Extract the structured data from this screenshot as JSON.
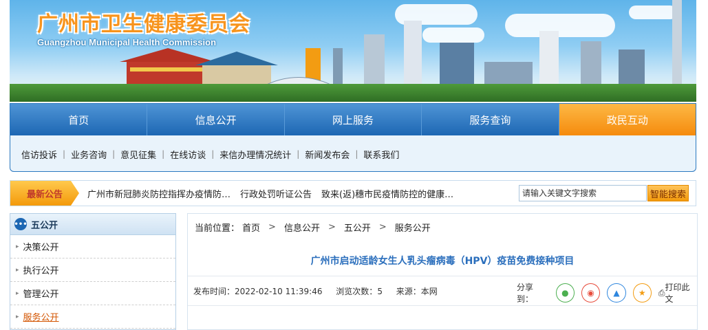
{
  "banner": {
    "title": "广州市卫生健康委员会",
    "subtitle": "Guangzhou Municipal Health Commission"
  },
  "nav": {
    "main": [
      "首页",
      "信息公开",
      "网上服务",
      "服务查询",
      "政民互动"
    ],
    "active_index": 4,
    "sub": [
      "信访投诉",
      "业务咨询",
      "意见征集",
      "在线访谈",
      "来信办理情况统计",
      "新闻发布会",
      "联系我们"
    ]
  },
  "notice": {
    "tag": "最新公告",
    "items": [
      "广州市新冠肺炎防控指挥办疫情防…",
      "行政处罚听证公告",
      "致来(返)穗市民疫情防控的健康…"
    ]
  },
  "search": {
    "placeholder": "请输入关键文字搜索",
    "button": "智能搜索"
  },
  "sidebar": {
    "title": "五公开",
    "items": [
      "决策公开",
      "执行公开",
      "管理公开",
      "服务公开"
    ],
    "current_index": 3
  },
  "breadcrumb": {
    "label": "当前位置：",
    "items": [
      "首页",
      "信息公开",
      "五公开",
      "服务公开"
    ]
  },
  "article": {
    "title": "广州市启动适龄女生人乳头瘤病毒（HPV）疫苗免费接种项目",
    "publish_label": "发布时间：",
    "publish_time": "2022-02-10 11:39:46",
    "views_label": "浏览次数：",
    "views": "5",
    "source_label": "来源：",
    "source": "本网",
    "share_label": "分享到：",
    "print_label": "打印此文"
  },
  "colors": {
    "nav_blue": "#1d67b3",
    "accent_orange": "#f39a0b",
    "title_blue": "#2a6ebc"
  }
}
